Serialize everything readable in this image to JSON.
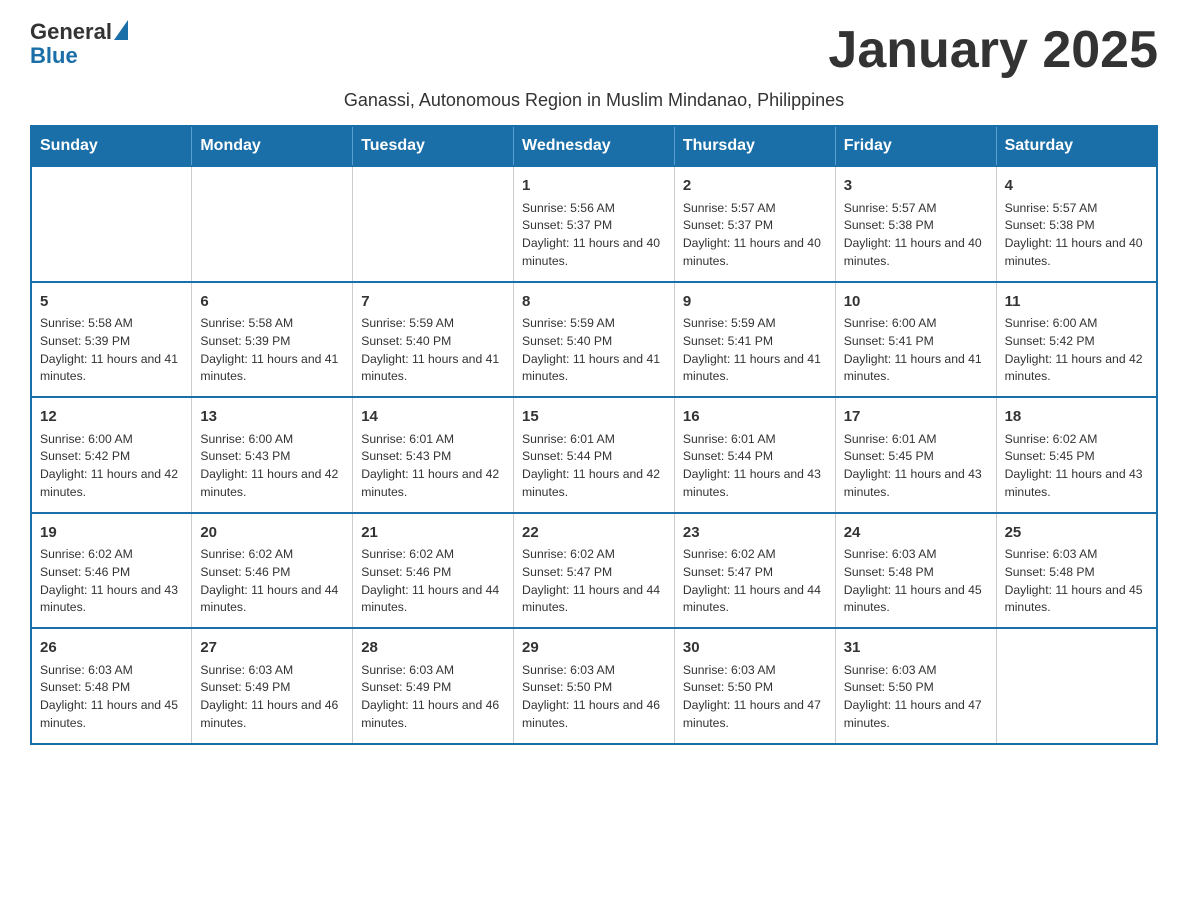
{
  "logo": {
    "text_general": "General",
    "triangle_shape": "▶",
    "text_blue": "Blue"
  },
  "header": {
    "month_title": "January 2025",
    "subtitle": "Ganassi, Autonomous Region in Muslim Mindanao, Philippines"
  },
  "weekdays": [
    "Sunday",
    "Monday",
    "Tuesday",
    "Wednesday",
    "Thursday",
    "Friday",
    "Saturday"
  ],
  "weeks": [
    {
      "days": [
        {
          "num": "",
          "info": ""
        },
        {
          "num": "",
          "info": ""
        },
        {
          "num": "",
          "info": ""
        },
        {
          "num": "1",
          "info": "Sunrise: 5:56 AM\nSunset: 5:37 PM\nDaylight: 11 hours and 40 minutes."
        },
        {
          "num": "2",
          "info": "Sunrise: 5:57 AM\nSunset: 5:37 PM\nDaylight: 11 hours and 40 minutes."
        },
        {
          "num": "3",
          "info": "Sunrise: 5:57 AM\nSunset: 5:38 PM\nDaylight: 11 hours and 40 minutes."
        },
        {
          "num": "4",
          "info": "Sunrise: 5:57 AM\nSunset: 5:38 PM\nDaylight: 11 hours and 40 minutes."
        }
      ]
    },
    {
      "days": [
        {
          "num": "5",
          "info": "Sunrise: 5:58 AM\nSunset: 5:39 PM\nDaylight: 11 hours and 41 minutes."
        },
        {
          "num": "6",
          "info": "Sunrise: 5:58 AM\nSunset: 5:39 PM\nDaylight: 11 hours and 41 minutes."
        },
        {
          "num": "7",
          "info": "Sunrise: 5:59 AM\nSunset: 5:40 PM\nDaylight: 11 hours and 41 minutes."
        },
        {
          "num": "8",
          "info": "Sunrise: 5:59 AM\nSunset: 5:40 PM\nDaylight: 11 hours and 41 minutes."
        },
        {
          "num": "9",
          "info": "Sunrise: 5:59 AM\nSunset: 5:41 PM\nDaylight: 11 hours and 41 minutes."
        },
        {
          "num": "10",
          "info": "Sunrise: 6:00 AM\nSunset: 5:41 PM\nDaylight: 11 hours and 41 minutes."
        },
        {
          "num": "11",
          "info": "Sunrise: 6:00 AM\nSunset: 5:42 PM\nDaylight: 11 hours and 42 minutes."
        }
      ]
    },
    {
      "days": [
        {
          "num": "12",
          "info": "Sunrise: 6:00 AM\nSunset: 5:42 PM\nDaylight: 11 hours and 42 minutes."
        },
        {
          "num": "13",
          "info": "Sunrise: 6:00 AM\nSunset: 5:43 PM\nDaylight: 11 hours and 42 minutes."
        },
        {
          "num": "14",
          "info": "Sunrise: 6:01 AM\nSunset: 5:43 PM\nDaylight: 11 hours and 42 minutes."
        },
        {
          "num": "15",
          "info": "Sunrise: 6:01 AM\nSunset: 5:44 PM\nDaylight: 11 hours and 42 minutes."
        },
        {
          "num": "16",
          "info": "Sunrise: 6:01 AM\nSunset: 5:44 PM\nDaylight: 11 hours and 43 minutes."
        },
        {
          "num": "17",
          "info": "Sunrise: 6:01 AM\nSunset: 5:45 PM\nDaylight: 11 hours and 43 minutes."
        },
        {
          "num": "18",
          "info": "Sunrise: 6:02 AM\nSunset: 5:45 PM\nDaylight: 11 hours and 43 minutes."
        }
      ]
    },
    {
      "days": [
        {
          "num": "19",
          "info": "Sunrise: 6:02 AM\nSunset: 5:46 PM\nDaylight: 11 hours and 43 minutes."
        },
        {
          "num": "20",
          "info": "Sunrise: 6:02 AM\nSunset: 5:46 PM\nDaylight: 11 hours and 44 minutes."
        },
        {
          "num": "21",
          "info": "Sunrise: 6:02 AM\nSunset: 5:46 PM\nDaylight: 11 hours and 44 minutes."
        },
        {
          "num": "22",
          "info": "Sunrise: 6:02 AM\nSunset: 5:47 PM\nDaylight: 11 hours and 44 minutes."
        },
        {
          "num": "23",
          "info": "Sunrise: 6:02 AM\nSunset: 5:47 PM\nDaylight: 11 hours and 44 minutes."
        },
        {
          "num": "24",
          "info": "Sunrise: 6:03 AM\nSunset: 5:48 PM\nDaylight: 11 hours and 45 minutes."
        },
        {
          "num": "25",
          "info": "Sunrise: 6:03 AM\nSunset: 5:48 PM\nDaylight: 11 hours and 45 minutes."
        }
      ]
    },
    {
      "days": [
        {
          "num": "26",
          "info": "Sunrise: 6:03 AM\nSunset: 5:48 PM\nDaylight: 11 hours and 45 minutes."
        },
        {
          "num": "27",
          "info": "Sunrise: 6:03 AM\nSunset: 5:49 PM\nDaylight: 11 hours and 46 minutes."
        },
        {
          "num": "28",
          "info": "Sunrise: 6:03 AM\nSunset: 5:49 PM\nDaylight: 11 hours and 46 minutes."
        },
        {
          "num": "29",
          "info": "Sunrise: 6:03 AM\nSunset: 5:50 PM\nDaylight: 11 hours and 46 minutes."
        },
        {
          "num": "30",
          "info": "Sunrise: 6:03 AM\nSunset: 5:50 PM\nDaylight: 11 hours and 47 minutes."
        },
        {
          "num": "31",
          "info": "Sunrise: 6:03 AM\nSunset: 5:50 PM\nDaylight: 11 hours and 47 minutes."
        },
        {
          "num": "",
          "info": ""
        }
      ]
    }
  ]
}
